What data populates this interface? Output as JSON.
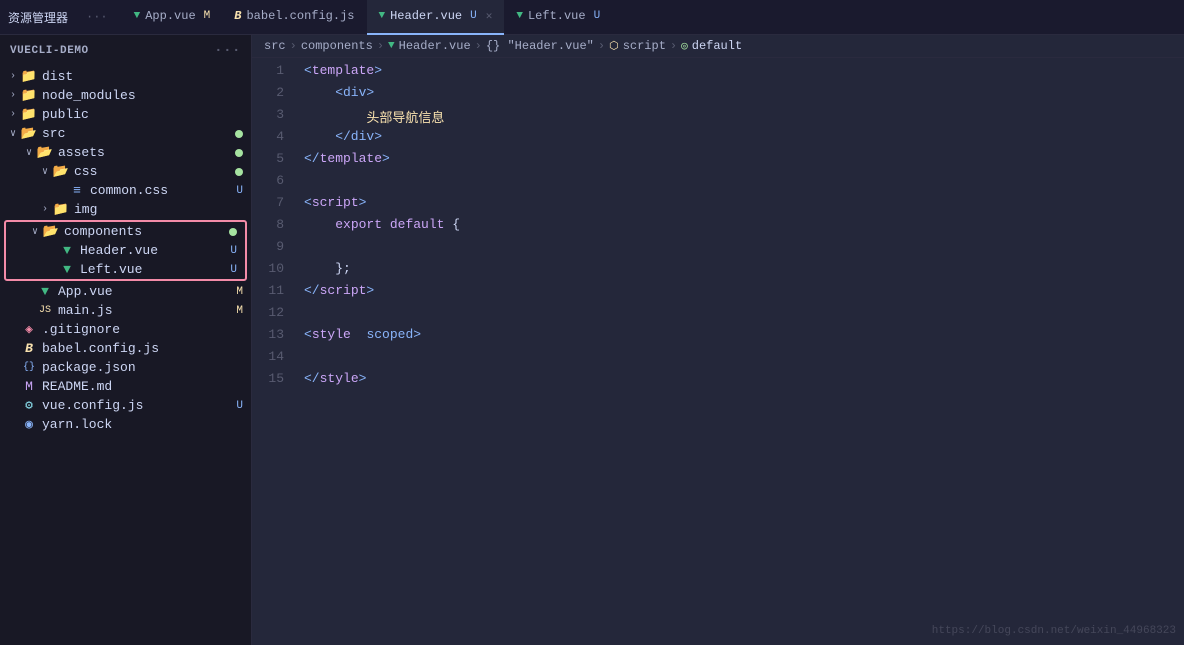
{
  "titlebar": {
    "explorer_label": "资源管理器",
    "tabs": [
      {
        "id": "app-vue",
        "name": "App.vue",
        "icon": "vue",
        "badge": "M",
        "active": false
      },
      {
        "id": "babel-config",
        "name": "babel.config.js",
        "icon": "babel",
        "badge": "",
        "active": false
      },
      {
        "id": "header-vue",
        "name": "Header.vue",
        "icon": "vue",
        "badge": "U",
        "active": true,
        "closeable": true
      },
      {
        "id": "left-vue",
        "name": "Left.vue",
        "icon": "vue",
        "badge": "U",
        "active": false
      }
    ]
  },
  "breadcrumb": {
    "items": [
      "src",
      "components",
      "Header.vue",
      "{} \"Header.vue\"",
      "script",
      "default"
    ]
  },
  "sidebar": {
    "project_name": "VUECLI-DEMO",
    "tree": [
      {
        "id": "dist",
        "type": "folder",
        "name": "dist",
        "level": 1,
        "collapsed": true
      },
      {
        "id": "node_modules",
        "type": "folder",
        "name": "node_modules",
        "level": 1,
        "collapsed": true
      },
      {
        "id": "public",
        "type": "folder",
        "name": "public",
        "level": 1,
        "collapsed": true
      },
      {
        "id": "src",
        "type": "folder",
        "name": "src",
        "level": 1,
        "collapsed": false,
        "badge": "dot"
      },
      {
        "id": "assets",
        "type": "folder",
        "name": "assets",
        "level": 2,
        "collapsed": false,
        "badge": "dot"
      },
      {
        "id": "css",
        "type": "folder",
        "name": "css",
        "level": 3,
        "collapsed": false,
        "badge": "dot"
      },
      {
        "id": "common-css",
        "type": "css",
        "name": "common.css",
        "level": 4,
        "badge": "U"
      },
      {
        "id": "img",
        "type": "folder",
        "name": "img",
        "level": 3,
        "collapsed": true
      },
      {
        "id": "components",
        "type": "folder",
        "name": "components",
        "level": 2,
        "collapsed": false,
        "badge": "dot",
        "highlighted": true
      },
      {
        "id": "header-vue",
        "type": "vue",
        "name": "Header.vue",
        "level": 3,
        "badge": "U",
        "highlighted": true
      },
      {
        "id": "left-vue",
        "type": "vue",
        "name": "Left.vue",
        "level": 3,
        "badge": "U",
        "highlighted": true
      },
      {
        "id": "app-vue",
        "type": "vue",
        "name": "App.vue",
        "level": 2,
        "badge": "M"
      },
      {
        "id": "main-js",
        "type": "js",
        "name": "main.js",
        "level": 2,
        "badge": "M"
      },
      {
        "id": "gitignore",
        "type": "git",
        "name": ".gitignore",
        "level": 1
      },
      {
        "id": "babel-config",
        "type": "babel",
        "name": "babel.config.js",
        "level": 1
      },
      {
        "id": "package-json",
        "type": "pkg",
        "name": "package.json",
        "level": 1
      },
      {
        "id": "readme",
        "type": "md",
        "name": "README.md",
        "level": 1
      },
      {
        "id": "vue-config",
        "type": "config",
        "name": "vue.config.js",
        "level": 1,
        "badge": "U"
      },
      {
        "id": "yarn-lock",
        "type": "yarn",
        "name": "yarn.lock",
        "level": 1
      }
    ]
  },
  "editor": {
    "lines": [
      {
        "num": 1,
        "tokens": [
          {
            "t": "<",
            "c": "kw-tag"
          },
          {
            "t": "template",
            "c": "kw-template"
          },
          {
            "t": ">",
            "c": "kw-tag"
          }
        ]
      },
      {
        "num": 2,
        "tokens": [
          {
            "t": "    <div>",
            "c": "kw-tag"
          }
        ]
      },
      {
        "num": 3,
        "tokens": [
          {
            "t": "        ",
            "c": ""
          },
          {
            "t": "头部导航信息",
            "c": "cn-text"
          }
        ]
      },
      {
        "num": 4,
        "tokens": [
          {
            "t": "    </div>",
            "c": "kw-tag"
          }
        ]
      },
      {
        "num": 5,
        "tokens": [
          {
            "t": "</",
            "c": "kw-tag"
          },
          {
            "t": "template",
            "c": "kw-template"
          },
          {
            "t": ">",
            "c": "kw-tag"
          }
        ]
      },
      {
        "num": 6,
        "tokens": []
      },
      {
        "num": 7,
        "tokens": [
          {
            "t": "<",
            "c": "kw-tag"
          },
          {
            "t": "script",
            "c": "kw-script"
          },
          {
            "t": ">",
            "c": "kw-tag"
          }
        ]
      },
      {
        "num": 8,
        "tokens": [
          {
            "t": "    ",
            "c": ""
          },
          {
            "t": "export",
            "c": "kw-export"
          },
          {
            "t": " ",
            "c": ""
          },
          {
            "t": "default",
            "c": "kw-default"
          },
          {
            "t": " {",
            "c": "punct"
          }
        ]
      },
      {
        "num": 9,
        "tokens": []
      },
      {
        "num": 10,
        "tokens": [
          {
            "t": "    };",
            "c": "punct"
          }
        ]
      },
      {
        "num": 11,
        "tokens": [
          {
            "t": "</",
            "c": "kw-tag"
          },
          {
            "t": "script",
            "c": "kw-script"
          },
          {
            "t": ">",
            "c": "kw-tag"
          }
        ]
      },
      {
        "num": 12,
        "tokens": []
      },
      {
        "num": 13,
        "tokens": [
          {
            "t": "<",
            "c": "kw-tag"
          },
          {
            "t": "style",
            "c": "kw-style"
          },
          {
            "t": "  ",
            "c": ""
          },
          {
            "t": "scoped",
            "c": "kw-scoped"
          },
          {
            "t": ">",
            "c": "kw-tag"
          }
        ]
      },
      {
        "num": 14,
        "tokens": []
      },
      {
        "num": 15,
        "tokens": [
          {
            "t": "</",
            "c": "kw-tag"
          },
          {
            "t": "style",
            "c": "kw-style"
          },
          {
            "t": ">",
            "c": "kw-tag"
          }
        ]
      }
    ]
  },
  "watermark": "https://blog.csdn.net/weixin_44968323"
}
